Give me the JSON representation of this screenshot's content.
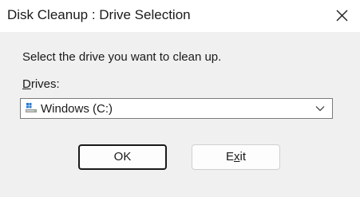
{
  "window": {
    "title": "Disk Cleanup : Drive Selection"
  },
  "prompt": "Select the drive you want to clean up.",
  "drives": {
    "label_accel": "D",
    "label_rest": "rives:",
    "selected": "Windows (C:)"
  },
  "buttons": {
    "ok": "OK",
    "exit_pre": "E",
    "exit_accel": "x",
    "exit_post": "it"
  },
  "icons": {
    "close": "close-icon",
    "drive": "drive-icon",
    "chevron": "chevron-down-icon"
  }
}
